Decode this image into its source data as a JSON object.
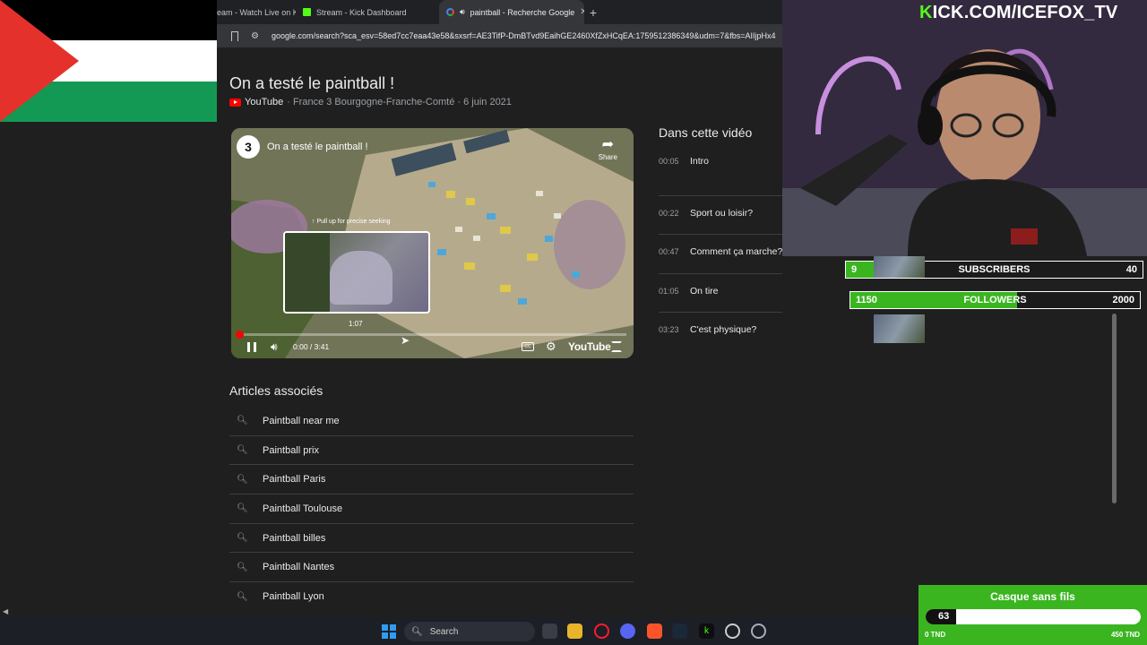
{
  "browser": {
    "tabs": [
      {
        "title": "eam - Watch Live on K",
        "favicon": "kick-favicon"
      },
      {
        "title": "Stream - Kick Dashboard",
        "favicon": "kick-favicon"
      },
      {
        "title": "paintball - Recherche Google",
        "favicon": "google-favicon",
        "active": true
      }
    ],
    "url": "google.com/search?sca_esv=58ed7cc7eaa43e58&sxsrf=AE3TifP-DmBTvd9EaihGE2460XfZxHCqEA:1759512386349&udm=7&fbs=AIIjpHx4"
  },
  "video": {
    "title": "On a testé le paintball !",
    "source_site": "YouTube",
    "source_rest": "· France 3 Bourgogne-Franche-Comté · 6 juin 2021",
    "player": {
      "channel_title": "On a testé le paintball !",
      "channel_logo": "3",
      "share_label": "Share",
      "seek_hint": "↑ Pull up for precise seeking",
      "hover_time": "1:07",
      "time_display": "0:00 / 3:41",
      "progress": 0.0,
      "brand": "YouTube"
    }
  },
  "chapters": {
    "heading": "Dans cette vidéo",
    "items": [
      {
        "time": "00:05",
        "name": "Intro"
      },
      {
        "time": "00:22",
        "name": "Sport ou loisir?"
      },
      {
        "time": "00:47",
        "name": "Comment ça marche?"
      },
      {
        "time": "01:05",
        "name": "On tire"
      },
      {
        "time": "03:23",
        "name": "C'est physique?"
      }
    ]
  },
  "related": {
    "heading": "Articles associés",
    "items": [
      "Paintball near me",
      "Paintball prix",
      "Paintball Paris",
      "Paintball Toulouse",
      "Paintball billes",
      "Paintball Nantes",
      "Paintball Lyon"
    ]
  },
  "overlay": {
    "kick_url_k": "K",
    "kick_url_rest": "ICK.COM/ICEFOX_TV",
    "subscribers": {
      "current": "9",
      "label": "SUBSCRIBERS",
      "goal": "40",
      "fraction": 0.225
    },
    "followers": {
      "current": "1150",
      "label": "FOLLOWERS",
      "goal": "2000",
      "fraction": 0.575
    },
    "donation_goal": {
      "title": "Casque sans fils",
      "value": "63",
      "min": "0 TND",
      "max": "450 TND",
      "fraction": 0.14
    }
  },
  "taskbar": {
    "search_placeholder": "Search"
  },
  "colors": {
    "kick_green": "#53fc18",
    "overlay_green": "#3ab520",
    "youtube_red": "#ff0000"
  }
}
